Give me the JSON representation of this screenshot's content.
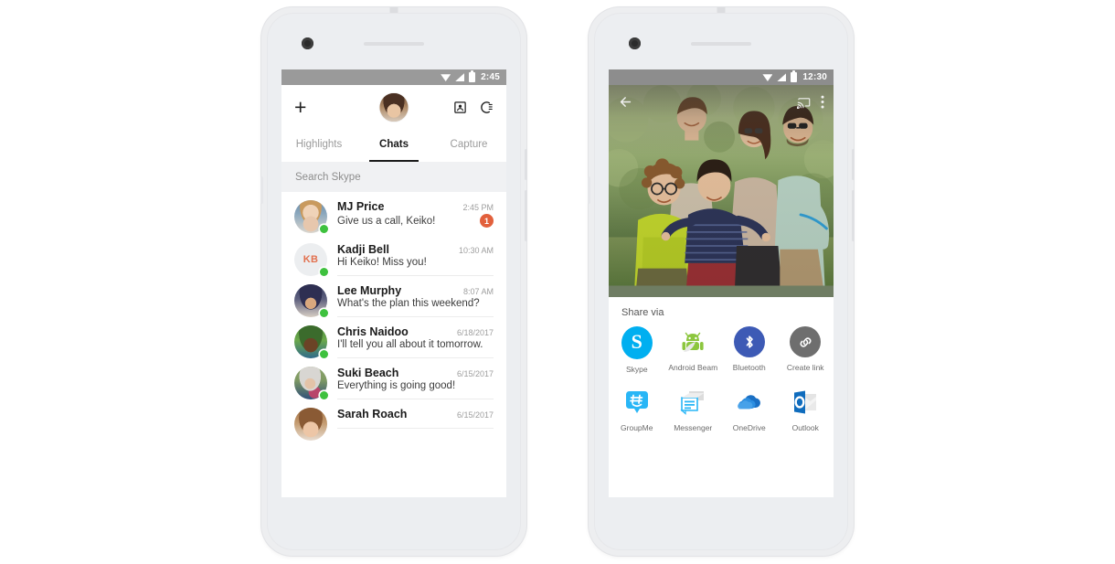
{
  "scene": {
    "description": "Two Android phone mockups side by side on white background",
    "background_color": "#ffffff",
    "frame_color": "#edeef0"
  },
  "phone_left": {
    "status_bar": {
      "time": "2:45",
      "icons": [
        "wifi-icon",
        "signal-icon",
        "battery-icon"
      ],
      "background_color": "#9a9a9a"
    },
    "app_bar": {
      "add_label": "+",
      "profile_avatar_name": "profile-avatar",
      "contacts_icon": "contacts-icon",
      "dialpad_icon": "call-history-icon"
    },
    "tabs": [
      {
        "label": "Highlights",
        "active": false
      },
      {
        "label": "Chats",
        "active": true
      },
      {
        "label": "Capture",
        "active": false
      }
    ],
    "search": {
      "placeholder": "Search Skype"
    },
    "chats": [
      {
        "name": "MJ Price",
        "preview": "Give us a call, Keiko!",
        "time": "2:45 PM",
        "unread": "1",
        "online": true,
        "avatar_type": "photo",
        "avatar_class": "f-mj",
        "wavy_separator": true
      },
      {
        "name": "Kadji Bell",
        "preview": "Hi Keiko! Miss you!",
        "time": "10:30 AM",
        "unread": "",
        "online": true,
        "avatar_type": "initials",
        "initials": "KB",
        "wavy_separator": false
      },
      {
        "name": "Lee Murphy",
        "preview": "What's the plan this weekend?",
        "time": "8:07 AM",
        "unread": "",
        "online": true,
        "avatar_type": "photo",
        "avatar_class": "f-lee",
        "wavy_separator": false
      },
      {
        "name": "Chris Naidoo",
        "preview": "I'll tell you all about it tomorrow.",
        "time": "6/18/2017",
        "unread": "",
        "online": true,
        "avatar_type": "photo",
        "avatar_class": "f-chris",
        "wavy_separator": false
      },
      {
        "name": "Suki Beach",
        "preview": "Everything is going good!",
        "time": "6/15/2017",
        "unread": "",
        "online": true,
        "avatar_type": "photo",
        "avatar_class": "f-suki",
        "wavy_separator": false
      },
      {
        "name": "Sarah Roach",
        "preview": "",
        "time": "6/15/2017",
        "unread": "",
        "online": false,
        "avatar_type": "photo",
        "avatar_class": "f-sarah",
        "wavy_separator": false
      }
    ],
    "colors": {
      "unread_badge": "#e2603c",
      "presence_online": "#3ec13e",
      "tab_active": "#1a1a1a"
    }
  },
  "phone_right": {
    "status_bar": {
      "time": "12:30",
      "icons": [
        "wifi-icon",
        "signal-icon",
        "battery-icon"
      ],
      "background_color": "#8d8d8d"
    },
    "photo_bar": {
      "back_icon": "back-arrow-icon",
      "cast_icon": "cast-icon",
      "overflow_icon": "overflow-menu-icon"
    },
    "photo": {
      "alt": "Family of five posing outdoors on grass in front of green hedge"
    },
    "share_sheet": {
      "title": "Share via",
      "targets": [
        {
          "label": "Skype",
          "icon": "skype-icon",
          "color": "#00aff0"
        },
        {
          "label": "Android Beam",
          "icon": "android-beam-icon",
          "color": "#8cc63e"
        },
        {
          "label": "Bluetooth",
          "icon": "bluetooth-icon",
          "color": "#3d5ab5"
        },
        {
          "label": "Create link",
          "icon": "link-icon",
          "color": "#6e6e6e"
        },
        {
          "label": "GroupMe",
          "icon": "groupme-icon",
          "color": "#29b6f6"
        },
        {
          "label": "Messenger",
          "icon": "messenger-icon",
          "color": "#29b6f6"
        },
        {
          "label": "OneDrive",
          "icon": "onedrive-icon",
          "color": "#1a6fc4"
        },
        {
          "label": "Outlook",
          "icon": "outlook-icon",
          "color": "#0f6cbd"
        }
      ]
    }
  }
}
